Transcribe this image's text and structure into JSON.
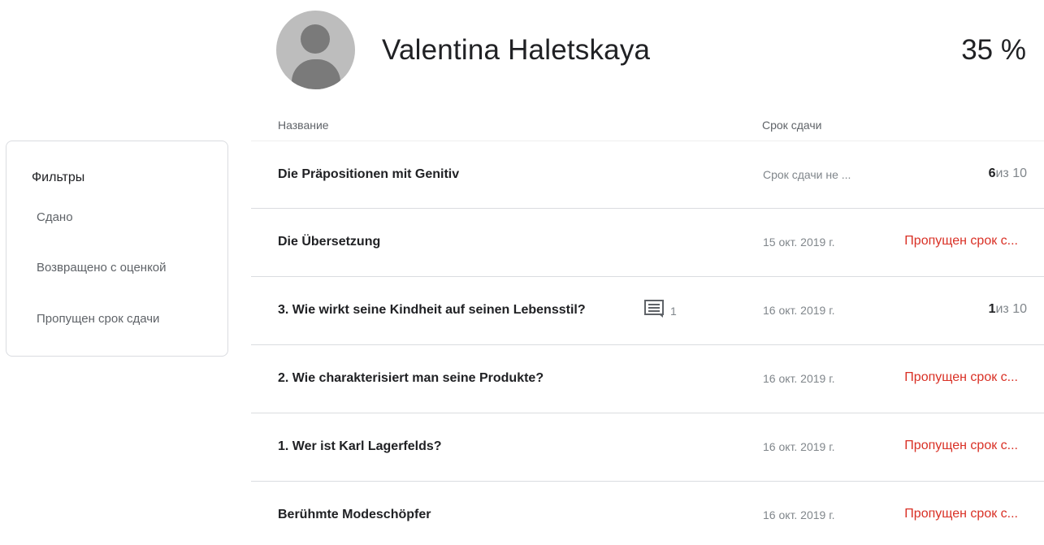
{
  "student": {
    "name": "Valentina Haletskaya",
    "percent": "35 %"
  },
  "columns": {
    "name": "Название",
    "due": "Срок сдачи"
  },
  "filters": {
    "title": "Фильтры",
    "items": [
      "Сдано",
      "Возвращено с оценкой",
      "Пропущен срок сдачи"
    ]
  },
  "assignments": [
    {
      "title": "Die Präpositionen mit Genitiv",
      "due": "Срок сдачи не ...",
      "grade": "6",
      "grade_of": "из 10",
      "status": ""
    },
    {
      "title": "Die Übersetzung",
      "due": "15 окт. 2019 г.",
      "grade": "",
      "grade_of": "",
      "status": "Пропущен срок с..."
    },
    {
      "title": "3. Wie wirkt seine Kindheit auf seinen Lebensstil?",
      "comments": "1",
      "due": "16 окт. 2019 г.",
      "grade": "1",
      "grade_of": "из 10",
      "status": ""
    },
    {
      "title": "2. Wie charakterisiert man seine Produkte?",
      "due": "16 окт. 2019 г.",
      "grade": "",
      "grade_of": "",
      "status": "Пропущен срок с..."
    },
    {
      "title": "1. Wer ist Karl Lagerfelds?",
      "due": "16 окт. 2019 г.",
      "grade": "",
      "grade_of": "",
      "status": "Пропущен срок с..."
    },
    {
      "title": "Berühmte Modeschöpfer",
      "due": "16 окт. 2019 г.",
      "grade": "",
      "grade_of": "",
      "status": "Пропущен срок с..."
    }
  ],
  "colors": {
    "missing": "#d93025",
    "muted": "#80868b",
    "border": "#dadce0"
  },
  "icons": {
    "avatar": "person-icon",
    "comment": "comment-icon"
  }
}
